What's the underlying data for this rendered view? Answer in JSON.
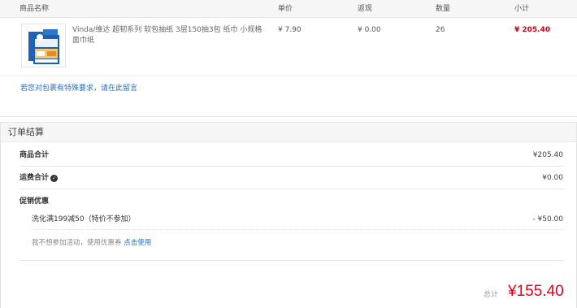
{
  "table": {
    "headers": {
      "product": "商品名称",
      "price": "单价",
      "adjust": "返现",
      "qty": "数量",
      "subtotal": "小计"
    },
    "rows": [
      {
        "name": "Vinda/维达 超韧系列 软包抽纸 3层150抽3包 纸巾 小规格 面巾纸",
        "price": "¥ 7.90",
        "adjust": "¥ 0.00",
        "qty": "26",
        "subtotal": "¥ 205.40",
        "image": "product-thumbnail"
      }
    ],
    "message_link": "若您对包裹有特殊要求，请在此留言"
  },
  "settlement": {
    "title": "订单结算",
    "goods_total_label": "商品合计",
    "goods_total_value": "¥205.40",
    "shipping_label": "运费合计",
    "shipping_icon": "info-icon",
    "shipping_value": "¥0.00",
    "promo_label": "促销优惠",
    "promo_item": "洗化满199减50（特价不参加）",
    "promo_value": "- ¥50.00",
    "no_promo_text": "我不想参加活动，使用优惠券",
    "no_promo_link": "点击使用",
    "total_label": "总计",
    "total_value": "¥155.40"
  },
  "colors": {
    "accent_red": "#e0021b",
    "link_blue": "#2a6ebb"
  }
}
